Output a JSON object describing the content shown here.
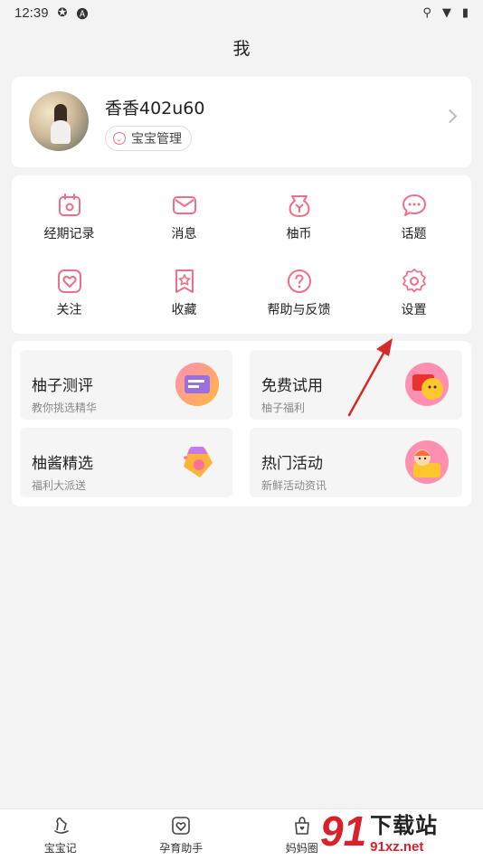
{
  "status_bar": {
    "time": "12:39",
    "left_icons": [
      "settings-sync-icon",
      "a-icon"
    ],
    "right_icons": [
      "location-icon",
      "wifi-icon",
      "battery-icon"
    ]
  },
  "header": {
    "title": "我"
  },
  "profile": {
    "username": "香香402u60",
    "baby_button_label": "宝宝管理"
  },
  "grid_items": [
    {
      "label": "经期记录",
      "icon": "calendar-icon"
    },
    {
      "label": "消息",
      "icon": "envelope-icon"
    },
    {
      "label": "柚币",
      "icon": "coin-bag-icon"
    },
    {
      "label": "话题",
      "icon": "chat-bubble-icon"
    },
    {
      "label": "关注",
      "icon": "heart-icon"
    },
    {
      "label": "收藏",
      "icon": "bookmark-star-icon"
    },
    {
      "label": "帮助与反馈",
      "icon": "question-icon"
    },
    {
      "label": "设置",
      "icon": "gear-icon"
    }
  ],
  "promos": [
    {
      "title": "柚子测评",
      "subtitle": "教你挑选精华"
    },
    {
      "title": "免费试用",
      "subtitle": "柚子福利"
    },
    {
      "title": "柚酱精选",
      "subtitle": "福利大派送"
    },
    {
      "title": "热门活动",
      "subtitle": "新鲜活动资讯"
    }
  ],
  "tabs": [
    {
      "label": "宝宝记",
      "icon": "rocking-horse-icon"
    },
    {
      "label": "孕育助手",
      "icon": "heart-card-icon"
    },
    {
      "label": "妈妈圈",
      "icon": "bag-icon"
    }
  ],
  "watermark": {
    "logo_digits": "91",
    "text": "下载站",
    "domain": "91xz.net"
  },
  "colors": {
    "accent": "#ef6f8a",
    "background": "#f3f3f3",
    "arrow": "#d62a2a"
  }
}
